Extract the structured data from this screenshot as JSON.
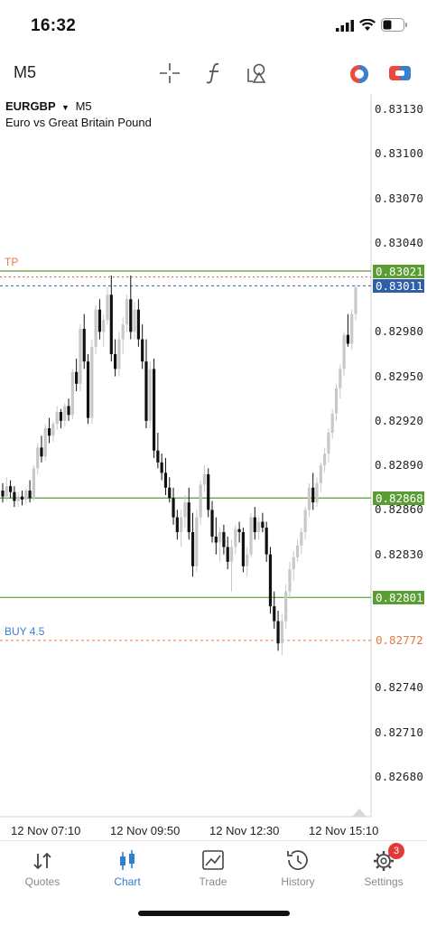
{
  "status": {
    "time": "16:32"
  },
  "toolbar": {
    "timeframe": "M5",
    "icons": [
      "crosshair-icon",
      "function-icon",
      "objects-icon",
      "one-click-trading-icon",
      "trade-panel-icon"
    ]
  },
  "chart_data": {
    "type": "candlestick",
    "symbol": "EURGBP",
    "timeframe": "M5",
    "description": "Euro vs Great Britain Pound",
    "ylim": [
      0.82665,
      0.83145
    ],
    "y_ticks": [
      "0.83130",
      "0.83100",
      "0.83070",
      "0.83040",
      "0.82980",
      "0.82950",
      "0.82920",
      "0.82890",
      "0.82860",
      "0.82830",
      "0.82740",
      "0.82710",
      "0.82680"
    ],
    "x_ticks": [
      "12 Nov 07:10",
      "12 Nov 09:50",
      "12 Nov 12:30",
      "12 Nov 15:10"
    ],
    "lines": [
      {
        "label": "TP",
        "price": 0.83021,
        "tag": "0.83021",
        "color": "#5a9e33"
      },
      {
        "label": "",
        "price": 0.83011,
        "tag": "0.83011",
        "color": "#2f5fa8"
      },
      {
        "label": "",
        "price": 0.82868,
        "tag": "0.82868",
        "color": "#5a9e33"
      },
      {
        "label": "",
        "price": 0.82801,
        "tag": "0.82801",
        "color": "#5a9e33"
      },
      {
        "label": "BUY 4.5",
        "price": 0.82772,
        "tag": "0.82772",
        "color": "#e27a45"
      }
    ],
    "ask_line": 0.83017,
    "candles": [
      [
        0.82873,
        0.82878,
        0.82865,
        0.82869
      ],
      [
        0.82869,
        0.82882,
        0.82866,
        0.82876
      ],
      [
        0.82876,
        0.8288,
        0.82868,
        0.82872
      ],
      [
        0.82872,
        0.82876,
        0.82862,
        0.82866
      ],
      [
        0.82866,
        0.82872,
        0.82862,
        0.82869
      ],
      [
        0.82869,
        0.82873,
        0.82863,
        0.82867
      ],
      [
        0.82867,
        0.82875,
        0.82864,
        0.82873
      ],
      [
        0.82873,
        0.8288,
        0.82865,
        0.82868
      ],
      [
        0.82868,
        0.8289,
        0.82866,
        0.82888
      ],
      [
        0.82888,
        0.82905,
        0.82884,
        0.82902
      ],
      [
        0.82902,
        0.8291,
        0.82892,
        0.82896
      ],
      [
        0.82896,
        0.82918,
        0.82893,
        0.82915
      ],
      [
        0.82915,
        0.82922,
        0.82905,
        0.8291
      ],
      [
        0.8291,
        0.8292,
        0.82906,
        0.82918
      ],
      [
        0.82918,
        0.8293,
        0.82914,
        0.82926
      ],
      [
        0.82926,
        0.82928,
        0.82915,
        0.8292
      ],
      [
        0.8292,
        0.82932,
        0.82916,
        0.8293
      ],
      [
        0.8293,
        0.82935,
        0.8292,
        0.82924
      ],
      [
        0.82924,
        0.82955,
        0.82921,
        0.82953
      ],
      [
        0.82953,
        0.82962,
        0.8294,
        0.82945
      ],
      [
        0.82945,
        0.82985,
        0.8294,
        0.82982
      ],
      [
        0.82982,
        0.82992,
        0.82955,
        0.8296
      ],
      [
        0.8296,
        0.82965,
        0.82918,
        0.82922
      ],
      [
        0.82922,
        0.82975,
        0.82918,
        0.8297
      ],
      [
        0.8297,
        0.82998,
        0.82965,
        0.82995
      ],
      [
        0.82995,
        0.83002,
        0.82975,
        0.8298
      ],
      [
        0.8298,
        0.82992,
        0.8297,
        0.82988
      ],
      [
        0.82988,
        0.8301,
        0.82985,
        0.83005
      ],
      [
        0.83005,
        0.83018,
        0.8296,
        0.82965
      ],
      [
        0.82965,
        0.82975,
        0.8295,
        0.82955
      ],
      [
        0.82955,
        0.8298,
        0.8295,
        0.82975
      ],
      [
        0.82975,
        0.8299,
        0.82965,
        0.82985
      ],
      [
        0.82985,
        0.83005,
        0.8298,
        0.83002
      ],
      [
        0.83002,
        0.83018,
        0.82975,
        0.8298
      ],
      [
        0.8298,
        0.83,
        0.82975,
        0.82995
      ],
      [
        0.82995,
        0.83002,
        0.8297,
        0.82975
      ],
      [
        0.82975,
        0.82985,
        0.82955,
        0.8296
      ],
      [
        0.8296,
        0.82975,
        0.82915,
        0.8292
      ],
      [
        0.8292,
        0.8296,
        0.82915,
        0.82955
      ],
      [
        0.82955,
        0.82962,
        0.82895,
        0.829
      ],
      [
        0.829,
        0.82912,
        0.82888,
        0.82892
      ],
      [
        0.82892,
        0.82898,
        0.8288,
        0.82885
      ],
      [
        0.82885,
        0.82895,
        0.8287,
        0.82875
      ],
      [
        0.82875,
        0.82882,
        0.82865,
        0.82868
      ],
      [
        0.82868,
        0.82875,
        0.8285,
        0.82855
      ],
      [
        0.82855,
        0.8286,
        0.8284,
        0.82845
      ],
      [
        0.82845,
        0.8286,
        0.82835,
        0.82855
      ],
      [
        0.82855,
        0.8287,
        0.82848,
        0.82865
      ],
      [
        0.82865,
        0.82875,
        0.8284,
        0.82845
      ],
      [
        0.82845,
        0.82858,
        0.82815,
        0.82822
      ],
      [
        0.82822,
        0.8286,
        0.82818,
        0.82855
      ],
      [
        0.82855,
        0.8288,
        0.8285,
        0.82877
      ],
      [
        0.82877,
        0.8289,
        0.82872,
        0.82884
      ],
      [
        0.82884,
        0.82888,
        0.82855,
        0.8286
      ],
      [
        0.8286,
        0.82866,
        0.82838,
        0.82842
      ],
      [
        0.82842,
        0.82855,
        0.8283,
        0.82838
      ],
      [
        0.82838,
        0.82848,
        0.82825,
        0.82845
      ],
      [
        0.82845,
        0.8285,
        0.8283,
        0.82835
      ],
      [
        0.82835,
        0.82842,
        0.8282,
        0.82825
      ],
      [
        0.82825,
        0.8284,
        0.82805,
        0.82835
      ],
      [
        0.82835,
        0.8285,
        0.8283,
        0.82847
      ],
      [
        0.82847,
        0.82852,
        0.82838,
        0.82845
      ],
      [
        0.82845,
        0.82848,
        0.82818,
        0.82822
      ],
      [
        0.82822,
        0.82835,
        0.82815,
        0.8283
      ],
      [
        0.8283,
        0.82858,
        0.82828,
        0.82855
      ],
      [
        0.82855,
        0.82862,
        0.8284,
        0.82845
      ],
      [
        0.82845,
        0.82855,
        0.8284,
        0.82852
      ],
      [
        0.82852,
        0.82858,
        0.82845,
        0.82848
      ],
      [
        0.82848,
        0.82852,
        0.82825,
        0.8283
      ],
      [
        0.8283,
        0.82835,
        0.8279,
        0.82795
      ],
      [
        0.82795,
        0.82805,
        0.8278,
        0.82785
      ],
      [
        0.82785,
        0.82792,
        0.82765,
        0.8277
      ],
      [
        0.8277,
        0.8279,
        0.82762,
        0.82785
      ],
      [
        0.82785,
        0.8281,
        0.8278,
        0.82805
      ],
      [
        0.82805,
        0.82825,
        0.828,
        0.8282
      ],
      [
        0.8282,
        0.82832,
        0.82812,
        0.82828
      ],
      [
        0.82828,
        0.8284,
        0.82825,
        0.82836
      ],
      [
        0.82836,
        0.82848,
        0.8283,
        0.82845
      ],
      [
        0.82845,
        0.82862,
        0.8284,
        0.8286
      ],
      [
        0.8286,
        0.82878,
        0.82855,
        0.82875
      ],
      [
        0.82875,
        0.82885,
        0.8286,
        0.82865
      ],
      [
        0.82865,
        0.82882,
        0.82862,
        0.82878
      ],
      [
        0.82878,
        0.82892,
        0.82872,
        0.8289
      ],
      [
        0.8289,
        0.82902,
        0.82885,
        0.82898
      ],
      [
        0.82898,
        0.82915,
        0.82892,
        0.82912
      ],
      [
        0.82912,
        0.82928,
        0.82908,
        0.82925
      ],
      [
        0.82925,
        0.82945,
        0.8292,
        0.82942
      ],
      [
        0.82942,
        0.82958,
        0.82935,
        0.82955
      ],
      [
        0.82955,
        0.8298,
        0.8295,
        0.82978
      ],
      [
        0.82978,
        0.82992,
        0.8297,
        0.82972
      ],
      [
        0.82972,
        0.82995,
        0.82968,
        0.82992
      ],
      [
        0.82992,
        0.83012,
        0.82988,
        0.8301
      ]
    ]
  },
  "nav": [
    {
      "label": "Quotes",
      "icon": "quotes-icon",
      "active": false
    },
    {
      "label": "Chart",
      "icon": "chart-icon",
      "active": true
    },
    {
      "label": "Trade",
      "icon": "trade-icon",
      "active": false
    },
    {
      "label": "History",
      "icon": "history-icon",
      "active": false
    },
    {
      "label": "Settings",
      "icon": "settings-icon",
      "active": false,
      "badge": "3"
    }
  ]
}
